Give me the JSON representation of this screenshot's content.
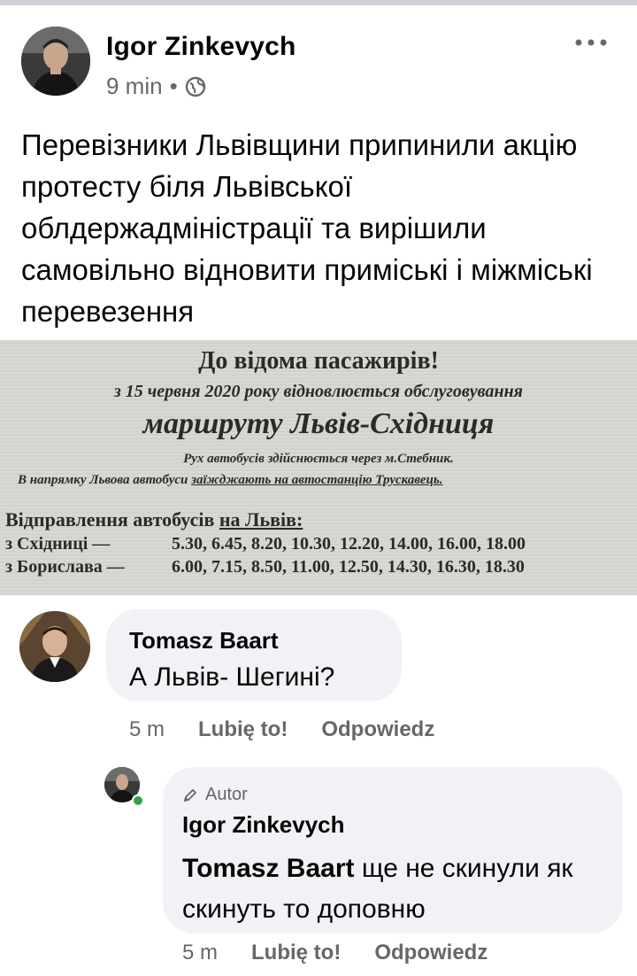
{
  "post": {
    "author": "Igor Zinkevych",
    "time": "9 min",
    "dot": "•",
    "text": "Перевізники Львівщини припинили акцію протесту біля Львівської облдержадміністрації та вирішили самовільно відновити приміські і міжміські перевезення"
  },
  "notice": {
    "title": "До відома пасажирів!",
    "line2": "з 15 червня 2020 року відновлюється обслуговування",
    "route": "маршруту Львів-Східниця",
    "line4": "Рух автобусів здійснюється через м.Стебник.",
    "line5_a": "В напрямку Львова автобуси ",
    "line5_b": "заїжджають на автостанцію Трускавець.",
    "schedule_a": "Відправлення автобусів ",
    "schedule_b": "на Львів:",
    "rows": [
      {
        "from": "з Східниці —",
        "times": "5.30, 6.45, 8.20, 10.30, 12.20, 14.00, 16.00, 18.00"
      },
      {
        "from": "з Борислава — ",
        "times": "6.00, 7.15, 8.50, 11.00, 12.50, 14.30, 16.30, 18.30"
      }
    ]
  },
  "comments": [
    {
      "name": "Tomasz Baart",
      "text": "А Львів- Шегині?",
      "time": "5 m",
      "like": "Lubię to!",
      "reply": "Odpowiedz"
    },
    {
      "badge": "Autor",
      "name": "Igor Zinkevych",
      "mention": "Tomasz Baart",
      "text": " ще не скинули як скинуть то доповню",
      "time": "5 m",
      "like": "Lubię to!",
      "reply": "Odpowiedz"
    }
  ],
  "colors": {
    "secondary_text": "#65676b",
    "bubble": "#f0f2f5",
    "online": "#31a24c"
  }
}
